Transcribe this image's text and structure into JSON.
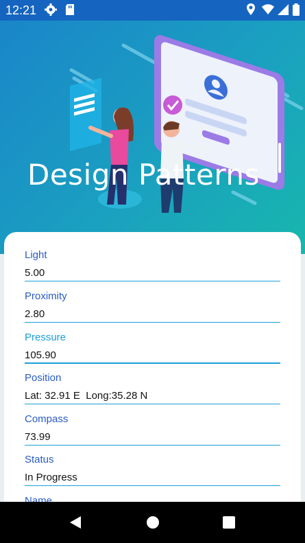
{
  "status_bar": {
    "time": "12:21",
    "icons": [
      "gear-icon",
      "sd-card-icon",
      "location-icon",
      "wifi-icon",
      "signal-icon",
      "battery-icon"
    ]
  },
  "hero": {
    "title": "Design Patterns"
  },
  "form": {
    "fields": [
      {
        "label": "Light",
        "value": "5.00"
      },
      {
        "label": "Proximity",
        "value": "2.80"
      },
      {
        "label": "Pressure",
        "value": "105.90"
      },
      {
        "label": "Position",
        "value": "Lat: 32.91 E  Long:35.28 N"
      },
      {
        "label": "Compass",
        "value": "73.99"
      },
      {
        "label": "Status",
        "value": "In Progress"
      },
      {
        "label": "Name",
        "value": ""
      }
    ]
  },
  "colors": {
    "status_bar": "#1565c0",
    "accent": "#1aa0d8",
    "label": "#2a5bc4"
  },
  "nav_bar": {
    "icons": [
      "back-icon",
      "home-icon",
      "recents-icon"
    ]
  }
}
